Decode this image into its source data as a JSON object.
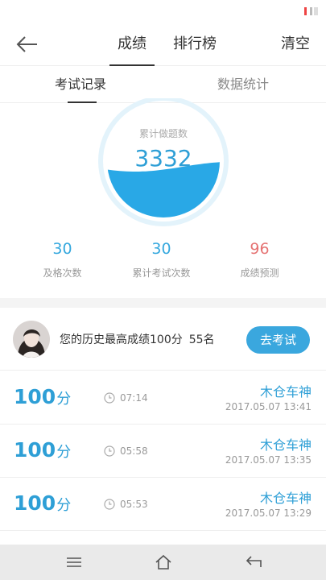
{
  "header": {
    "tabs": [
      "成绩",
      "排行榜"
    ],
    "clear_label": "清空"
  },
  "sub_tabs": [
    "考试记录",
    "数据统计"
  ],
  "gauge": {
    "label": "累计做题数",
    "value": "3332",
    "fill_level": 0.45,
    "color": "#29a8e6"
  },
  "stats": [
    {
      "value": "30",
      "label": "及格次数"
    },
    {
      "value": "30",
      "label": "累计考试次数"
    },
    {
      "value": "96",
      "label": "成绩预测"
    }
  ],
  "best": {
    "text": "您的历史最高成绩100分",
    "rank": "55名",
    "button_label": "去考试"
  },
  "records": [
    {
      "score": "100",
      "unit": "分",
      "duration": "07:14",
      "name": "木仓车神",
      "date": "2017.05.07  13:41"
    },
    {
      "score": "100",
      "unit": "分",
      "duration": "05:58",
      "name": "木仓车神",
      "date": "2017.05.07  13:35"
    },
    {
      "score": "100",
      "unit": "分",
      "duration": "05:53",
      "name": "木仓车神",
      "date": "2017.05.07  13:29"
    }
  ],
  "colors": {
    "accent": "#2e9fd6",
    "prediction": "#e57373",
    "button": "#3aa7de"
  },
  "icons": {
    "back": "arrow-left-icon",
    "clock": "clock-icon",
    "menu": "menu-icon",
    "home": "home-icon",
    "return": "return-icon"
  }
}
